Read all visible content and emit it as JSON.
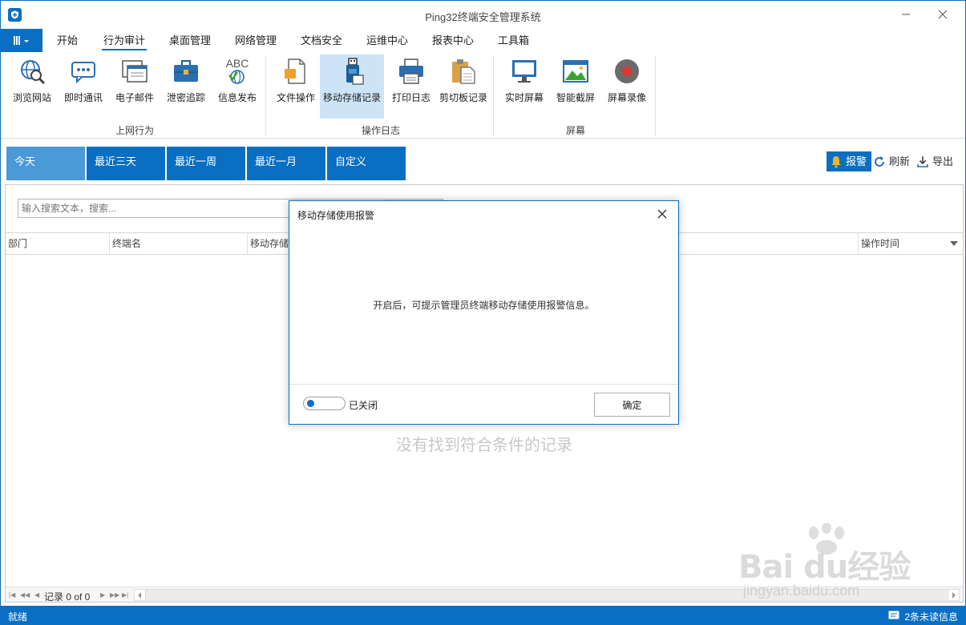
{
  "window": {
    "title": "Ping32终端安全管理系统"
  },
  "menu": {
    "tabs": [
      "开始",
      "行为审计",
      "桌面管理",
      "网络管理",
      "文档安全",
      "运维中心",
      "报表中心",
      "工具箱"
    ],
    "active": "行为审计"
  },
  "ribbon": {
    "groups": [
      {
        "label": "上网行为",
        "items": [
          "浏览网站",
          "即时通讯",
          "电子邮件",
          "泄密追踪",
          "信息发布"
        ]
      },
      {
        "label": "操作日志",
        "items": [
          "文件操作",
          "移动存储记录",
          "打印日志",
          "剪切板记录"
        ]
      },
      {
        "label": "屏幕",
        "items": [
          "实时屏幕",
          "智能截屏",
          "屏幕录像"
        ]
      }
    ],
    "selected": "移动存储记录",
    "abc_glyph": "ABC"
  },
  "date_filters": {
    "items": [
      "今天",
      "最近三天",
      "最近一周",
      "最近一月",
      "自定义"
    ],
    "active": "今天"
  },
  "toolbar": {
    "alarm": "报警",
    "refresh": "刷新",
    "export": "导出"
  },
  "search": {
    "placeholder": "输入搜索文本，搜索..."
  },
  "grid": {
    "columns": [
      "部门",
      "终端名",
      "移动存储",
      "操作时间"
    ],
    "empty_message": "没有找到符合条件的记录"
  },
  "pager": {
    "text": "记录 0 of 0"
  },
  "status": {
    "left": "就绪",
    "right": "2条未读信息"
  },
  "watermark": {
    "brand": "Bai du经验",
    "url": "jingyan.baidu.com"
  },
  "dialog": {
    "title": "移动存储使用报警",
    "message": "开启后，可提示管理员终端移动存储使用报警信息。",
    "toggle_label": "已关闭",
    "toggle_on": false,
    "ok": "确定"
  },
  "colors": {
    "accent": "#0a6fc2",
    "active_tab": "#4a9ad8",
    "selected_ribbon": "#cde4f7"
  }
}
